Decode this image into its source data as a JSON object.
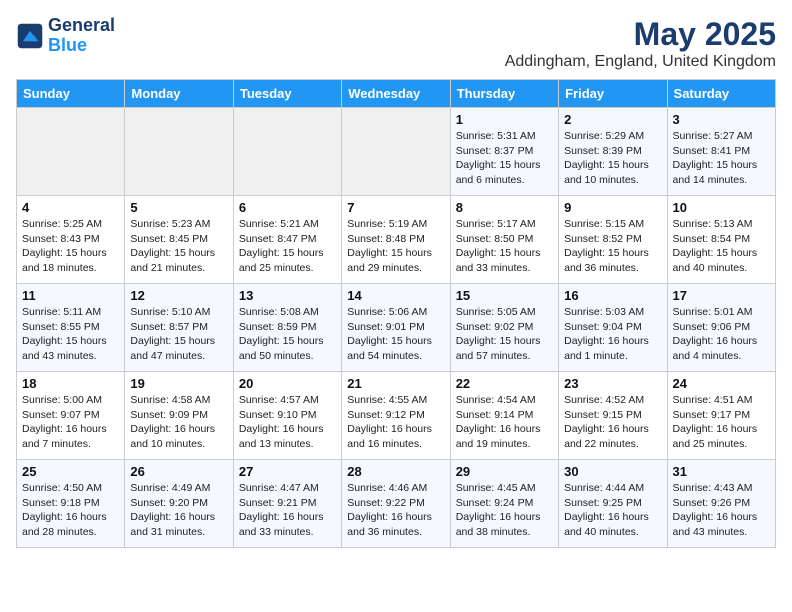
{
  "header": {
    "logo_line1": "General",
    "logo_line2": "Blue",
    "month": "May 2025",
    "location": "Addingham, England, United Kingdom"
  },
  "weekdays": [
    "Sunday",
    "Monday",
    "Tuesday",
    "Wednesday",
    "Thursday",
    "Friday",
    "Saturday"
  ],
  "weeks": [
    [
      {
        "day": "",
        "info": ""
      },
      {
        "day": "",
        "info": ""
      },
      {
        "day": "",
        "info": ""
      },
      {
        "day": "",
        "info": ""
      },
      {
        "day": "1",
        "info": "Sunrise: 5:31 AM\nSunset: 8:37 PM\nDaylight: 15 hours\nand 6 minutes."
      },
      {
        "day": "2",
        "info": "Sunrise: 5:29 AM\nSunset: 8:39 PM\nDaylight: 15 hours\nand 10 minutes."
      },
      {
        "day": "3",
        "info": "Sunrise: 5:27 AM\nSunset: 8:41 PM\nDaylight: 15 hours\nand 14 minutes."
      }
    ],
    [
      {
        "day": "4",
        "info": "Sunrise: 5:25 AM\nSunset: 8:43 PM\nDaylight: 15 hours\nand 18 minutes."
      },
      {
        "day": "5",
        "info": "Sunrise: 5:23 AM\nSunset: 8:45 PM\nDaylight: 15 hours\nand 21 minutes."
      },
      {
        "day": "6",
        "info": "Sunrise: 5:21 AM\nSunset: 8:47 PM\nDaylight: 15 hours\nand 25 minutes."
      },
      {
        "day": "7",
        "info": "Sunrise: 5:19 AM\nSunset: 8:48 PM\nDaylight: 15 hours\nand 29 minutes."
      },
      {
        "day": "8",
        "info": "Sunrise: 5:17 AM\nSunset: 8:50 PM\nDaylight: 15 hours\nand 33 minutes."
      },
      {
        "day": "9",
        "info": "Sunrise: 5:15 AM\nSunset: 8:52 PM\nDaylight: 15 hours\nand 36 minutes."
      },
      {
        "day": "10",
        "info": "Sunrise: 5:13 AM\nSunset: 8:54 PM\nDaylight: 15 hours\nand 40 minutes."
      }
    ],
    [
      {
        "day": "11",
        "info": "Sunrise: 5:11 AM\nSunset: 8:55 PM\nDaylight: 15 hours\nand 43 minutes."
      },
      {
        "day": "12",
        "info": "Sunrise: 5:10 AM\nSunset: 8:57 PM\nDaylight: 15 hours\nand 47 minutes."
      },
      {
        "day": "13",
        "info": "Sunrise: 5:08 AM\nSunset: 8:59 PM\nDaylight: 15 hours\nand 50 minutes."
      },
      {
        "day": "14",
        "info": "Sunrise: 5:06 AM\nSunset: 9:01 PM\nDaylight: 15 hours\nand 54 minutes."
      },
      {
        "day": "15",
        "info": "Sunrise: 5:05 AM\nSunset: 9:02 PM\nDaylight: 15 hours\nand 57 minutes."
      },
      {
        "day": "16",
        "info": "Sunrise: 5:03 AM\nSunset: 9:04 PM\nDaylight: 16 hours\nand 1 minute."
      },
      {
        "day": "17",
        "info": "Sunrise: 5:01 AM\nSunset: 9:06 PM\nDaylight: 16 hours\nand 4 minutes."
      }
    ],
    [
      {
        "day": "18",
        "info": "Sunrise: 5:00 AM\nSunset: 9:07 PM\nDaylight: 16 hours\nand 7 minutes."
      },
      {
        "day": "19",
        "info": "Sunrise: 4:58 AM\nSunset: 9:09 PM\nDaylight: 16 hours\nand 10 minutes."
      },
      {
        "day": "20",
        "info": "Sunrise: 4:57 AM\nSunset: 9:10 PM\nDaylight: 16 hours\nand 13 minutes."
      },
      {
        "day": "21",
        "info": "Sunrise: 4:55 AM\nSunset: 9:12 PM\nDaylight: 16 hours\nand 16 minutes."
      },
      {
        "day": "22",
        "info": "Sunrise: 4:54 AM\nSunset: 9:14 PM\nDaylight: 16 hours\nand 19 minutes."
      },
      {
        "day": "23",
        "info": "Sunrise: 4:52 AM\nSunset: 9:15 PM\nDaylight: 16 hours\nand 22 minutes."
      },
      {
        "day": "24",
        "info": "Sunrise: 4:51 AM\nSunset: 9:17 PM\nDaylight: 16 hours\nand 25 minutes."
      }
    ],
    [
      {
        "day": "25",
        "info": "Sunrise: 4:50 AM\nSunset: 9:18 PM\nDaylight: 16 hours\nand 28 minutes."
      },
      {
        "day": "26",
        "info": "Sunrise: 4:49 AM\nSunset: 9:20 PM\nDaylight: 16 hours\nand 31 minutes."
      },
      {
        "day": "27",
        "info": "Sunrise: 4:47 AM\nSunset: 9:21 PM\nDaylight: 16 hours\nand 33 minutes."
      },
      {
        "day": "28",
        "info": "Sunrise: 4:46 AM\nSunset: 9:22 PM\nDaylight: 16 hours\nand 36 minutes."
      },
      {
        "day": "29",
        "info": "Sunrise: 4:45 AM\nSunset: 9:24 PM\nDaylight: 16 hours\nand 38 minutes."
      },
      {
        "day": "30",
        "info": "Sunrise: 4:44 AM\nSunset: 9:25 PM\nDaylight: 16 hours\nand 40 minutes."
      },
      {
        "day": "31",
        "info": "Sunrise: 4:43 AM\nSunset: 9:26 PM\nDaylight: 16 hours\nand 43 minutes."
      }
    ]
  ]
}
